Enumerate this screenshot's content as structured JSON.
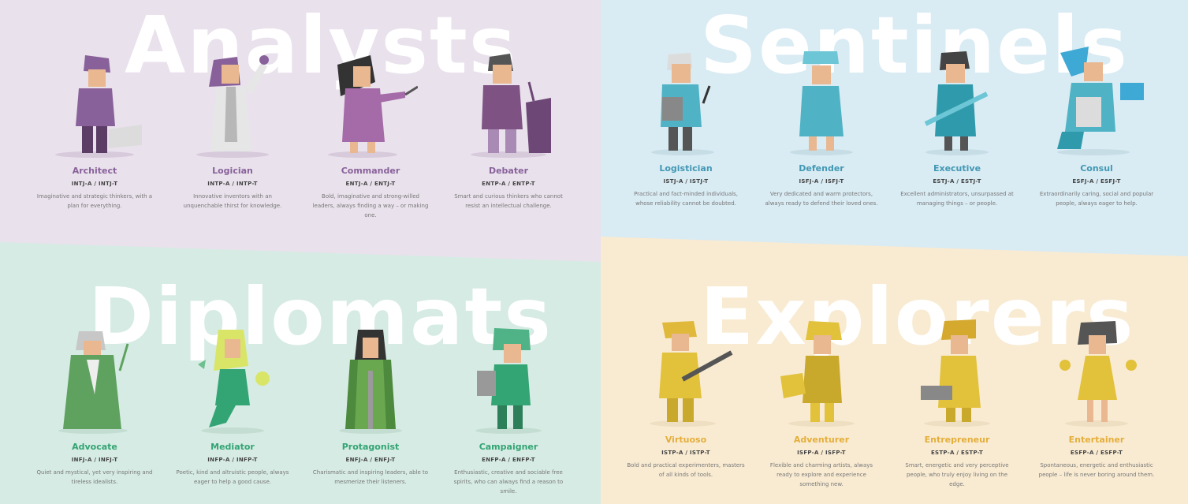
{
  "groups": {
    "analysts": {
      "title": "Analysts",
      "color": "#88619a",
      "bg": "#e9e1ec",
      "types": [
        {
          "name": "Architect",
          "code": "INTJ-A / INTJ-T",
          "desc": "Imaginative and strategic thinkers, with a plan for everything."
        },
        {
          "name": "Logician",
          "code": "INTP-A / INTP-T",
          "desc": "Innovative inventors with an unquenchable thirst for knowledge."
        },
        {
          "name": "Commander",
          "code": "ENTJ-A / ENTJ-T",
          "desc": "Bold, imaginative and strong-willed leaders, always finding a way – or making one."
        },
        {
          "name": "Debater",
          "code": "ENTP-A / ENTP-T",
          "desc": "Smart and curious thinkers who cannot resist an intellectual challenge."
        }
      ]
    },
    "sentinels": {
      "title": "Sentinels",
      "color": "#4298b4",
      "bg": "#d9ebf3",
      "types": [
        {
          "name": "Logistician",
          "code": "ISTJ-A / ISTJ-T",
          "desc": "Practical and fact-minded individuals, whose reliability cannot be doubted."
        },
        {
          "name": "Defender",
          "code": "ISFJ-A / ISFJ-T",
          "desc": "Very dedicated and warm protectors, always ready to defend their loved ones."
        },
        {
          "name": "Executive",
          "code": "ESTJ-A / ESTJ-T",
          "desc": "Excellent administrators, unsurpassed at managing things – or people."
        },
        {
          "name": "Consul",
          "code": "ESFJ-A / ESFJ-T",
          "desc": "Extraordinarily caring, social and popular people, always eager to help."
        }
      ]
    },
    "diplomats": {
      "title": "Diplomats",
      "color": "#33a474",
      "bg": "#d6ebe3",
      "types": [
        {
          "name": "Advocate",
          "code": "INFJ-A / INFJ-T",
          "desc": "Quiet and mystical, yet very inspiring and tireless idealists."
        },
        {
          "name": "Mediator",
          "code": "INFP-A / INFP-T",
          "desc": "Poetic, kind and altruistic people, always eager to help a good cause."
        },
        {
          "name": "Protagonist",
          "code": "ENFJ-A / ENFJ-T",
          "desc": "Charismatic and inspiring leaders, able to mesmerize their listeners."
        },
        {
          "name": "Campaigner",
          "code": "ENFP-A / ENFP-T",
          "desc": "Enthusiastic, creative and sociable free spirits, who can always find a reason to smile."
        }
      ]
    },
    "explorers": {
      "title": "Explorers",
      "color": "#e4ae3a",
      "bg": "#f9ebd2",
      "types": [
        {
          "name": "Virtuoso",
          "code": "ISTP-A / ISTP-T",
          "desc": "Bold and practical experimenters, masters of all kinds of tools."
        },
        {
          "name": "Adventurer",
          "code": "ISFP-A / ISFP-T",
          "desc": "Flexible and charming artists, always ready to explore and experience something new."
        },
        {
          "name": "Entrepreneur",
          "code": "ESTP-A / ESTP-T",
          "desc": "Smart, energetic and very perceptive people, who truly enjoy living on the edge."
        },
        {
          "name": "Entertainer",
          "code": "ESFP-A / ESFP-T",
          "desc": "Spontaneous, energetic and enthusiastic people – life is never boring around them."
        }
      ]
    }
  }
}
